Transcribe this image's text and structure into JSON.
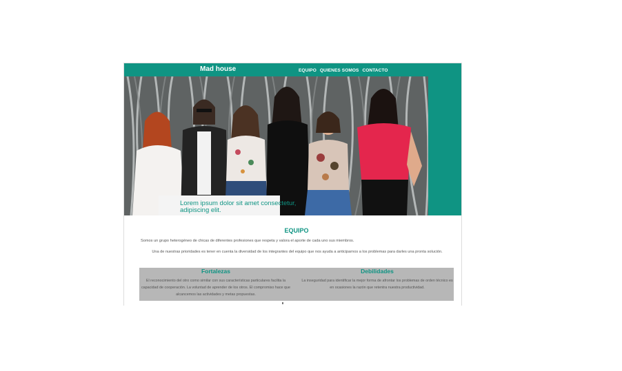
{
  "header": {
    "brand": "Mad house",
    "nav": [
      "EQUIPO",
      "QUIENES SOMOS",
      "CONTACTO"
    ]
  },
  "hero": {
    "caption": "Lorem ipsum dolor sit amet consectetur, adipiscing elit."
  },
  "main": {
    "title": "EQUIPO",
    "paragraph1": "Somos un grupo heterogéneo de chicas de diferentes profesiones que respeta y valora el aporte de cada uno sus miembros.",
    "paragraph2": "Una de nuestras prioridades es tener en cuenta la diversidad de los integrantes del equipo que nos ayuda a anticiparnos a los problemas para darles una pronta solución.",
    "strengths": {
      "title": "Fortalezas",
      "text": "El reconocimiento del otro como similar con sus características particulares facilita la capacidad de cooperación. La voluntad de aprender de los otros. El compromiso hace que alcancemos las actividades y metas propuestas."
    },
    "weaknesses": {
      "title": "Debilidades",
      "text": "La inseguridad para identificar la mejor forma de afrontar los problemas de orden técnico es en ocasiones la razón que retentra nuestra productividad."
    }
  },
  "colors": {
    "accent": "#0f9483",
    "panel": "#b7b7b7"
  }
}
